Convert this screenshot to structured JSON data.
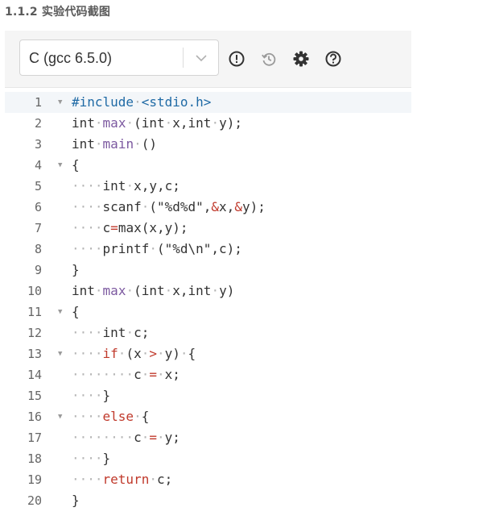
{
  "heading": "1.1.2 实验代码截图",
  "toolbar": {
    "language": "C (gcc 6.5.0)",
    "icons": [
      "info-icon",
      "history-icon",
      "settings-icon",
      "help-icon"
    ]
  },
  "colors": {
    "preprocessor": "#1f6aa5",
    "function": "#7c59a0",
    "control_keyword": "#c0392b",
    "operator": "#c0392b",
    "whitespace_marker": "#b5b5b5"
  },
  "editor": {
    "lines": [
      {
        "n": "1",
        "fold": true,
        "tokens": [
          [
            "pp",
            "#include"
          ],
          [
            "ws",
            "·"
          ],
          [
            "pp",
            "<stdio.h>"
          ]
        ]
      },
      {
        "n": "2",
        "fold": false,
        "tokens": [
          [
            "kw",
            "int"
          ],
          [
            "ws",
            "·"
          ],
          [
            "fn",
            "max"
          ],
          [
            "ws",
            "·"
          ],
          [
            "plain",
            "(int"
          ],
          [
            "ws",
            "·"
          ],
          [
            "plain",
            "x,int"
          ],
          [
            "ws",
            "·"
          ],
          [
            "plain",
            "y);"
          ]
        ]
      },
      {
        "n": "3",
        "fold": false,
        "tokens": [
          [
            "kw",
            "int"
          ],
          [
            "ws",
            "·"
          ],
          [
            "fn",
            "main"
          ],
          [
            "ws",
            "·"
          ],
          [
            "plain",
            "()"
          ]
        ]
      },
      {
        "n": "4",
        "fold": true,
        "tokens": [
          [
            "plain",
            "{"
          ]
        ]
      },
      {
        "n": "5",
        "fold": false,
        "tokens": [
          [
            "ws",
            "····"
          ],
          [
            "kw",
            "int"
          ],
          [
            "ws",
            "·"
          ],
          [
            "plain",
            "x,y,c;"
          ]
        ]
      },
      {
        "n": "6",
        "fold": false,
        "tokens": [
          [
            "ws",
            "····"
          ],
          [
            "plain",
            "scanf"
          ],
          [
            "ws",
            "·"
          ],
          [
            "plain",
            "(\"%d%d\","
          ],
          [
            "op",
            "&"
          ],
          [
            "plain",
            "x,"
          ],
          [
            "op",
            "&"
          ],
          [
            "plain",
            "y);"
          ]
        ]
      },
      {
        "n": "7",
        "fold": false,
        "tokens": [
          [
            "ws",
            "····"
          ],
          [
            "plain",
            "c"
          ],
          [
            "op",
            "="
          ],
          [
            "plain",
            "max(x,y);"
          ]
        ]
      },
      {
        "n": "8",
        "fold": false,
        "tokens": [
          [
            "ws",
            "····"
          ],
          [
            "plain",
            "printf"
          ],
          [
            "ws",
            "·"
          ],
          [
            "plain",
            "(\"%d\\n\",c);"
          ]
        ]
      },
      {
        "n": "9",
        "fold": false,
        "tokens": [
          [
            "plain",
            "}"
          ]
        ]
      },
      {
        "n": "10",
        "fold": false,
        "tokens": [
          [
            "kw",
            "int"
          ],
          [
            "ws",
            "·"
          ],
          [
            "fn",
            "max"
          ],
          [
            "ws",
            "·"
          ],
          [
            "plain",
            "(int"
          ],
          [
            "ws",
            "·"
          ],
          [
            "plain",
            "x,int"
          ],
          [
            "ws",
            "·"
          ],
          [
            "plain",
            "y)"
          ]
        ]
      },
      {
        "n": "11",
        "fold": true,
        "tokens": [
          [
            "plain",
            "{"
          ]
        ]
      },
      {
        "n": "12",
        "fold": false,
        "tokens": [
          [
            "ws",
            "····"
          ],
          [
            "kw",
            "int"
          ],
          [
            "ws",
            "·"
          ],
          [
            "plain",
            "c;"
          ]
        ]
      },
      {
        "n": "13",
        "fold": true,
        "tokens": [
          [
            "ws",
            "····"
          ],
          [
            "ctrl",
            "if"
          ],
          [
            "ws",
            "·"
          ],
          [
            "plain",
            "(x"
          ],
          [
            "ws",
            "·"
          ],
          [
            "op",
            ">"
          ],
          [
            "ws",
            "·"
          ],
          [
            "plain",
            "y)"
          ],
          [
            "ws",
            "·"
          ],
          [
            "plain",
            "{"
          ]
        ]
      },
      {
        "n": "14",
        "fold": false,
        "tokens": [
          [
            "ws",
            "········"
          ],
          [
            "plain",
            "c"
          ],
          [
            "ws",
            "·"
          ],
          [
            "op",
            "="
          ],
          [
            "ws",
            "·"
          ],
          [
            "plain",
            "x;"
          ]
        ]
      },
      {
        "n": "15",
        "fold": false,
        "tokens": [
          [
            "ws",
            "····"
          ],
          [
            "plain",
            "}"
          ]
        ]
      },
      {
        "n": "16",
        "fold": true,
        "tokens": [
          [
            "ws",
            "····"
          ],
          [
            "ctrl",
            "else"
          ],
          [
            "ws",
            "·"
          ],
          [
            "plain",
            "{"
          ]
        ]
      },
      {
        "n": "17",
        "fold": false,
        "tokens": [
          [
            "ws",
            "········"
          ],
          [
            "plain",
            "c"
          ],
          [
            "ws",
            "·"
          ],
          [
            "op",
            "="
          ],
          [
            "ws",
            "·"
          ],
          [
            "plain",
            "y;"
          ]
        ]
      },
      {
        "n": "18",
        "fold": false,
        "tokens": [
          [
            "ws",
            "····"
          ],
          [
            "plain",
            "}"
          ]
        ]
      },
      {
        "n": "19",
        "fold": false,
        "tokens": [
          [
            "ws",
            "····"
          ],
          [
            "ctrl",
            "return"
          ],
          [
            "ws",
            "·"
          ],
          [
            "plain",
            "c;"
          ]
        ]
      },
      {
        "n": "20",
        "fold": false,
        "tokens": [
          [
            "plain",
            "}"
          ]
        ]
      }
    ]
  }
}
